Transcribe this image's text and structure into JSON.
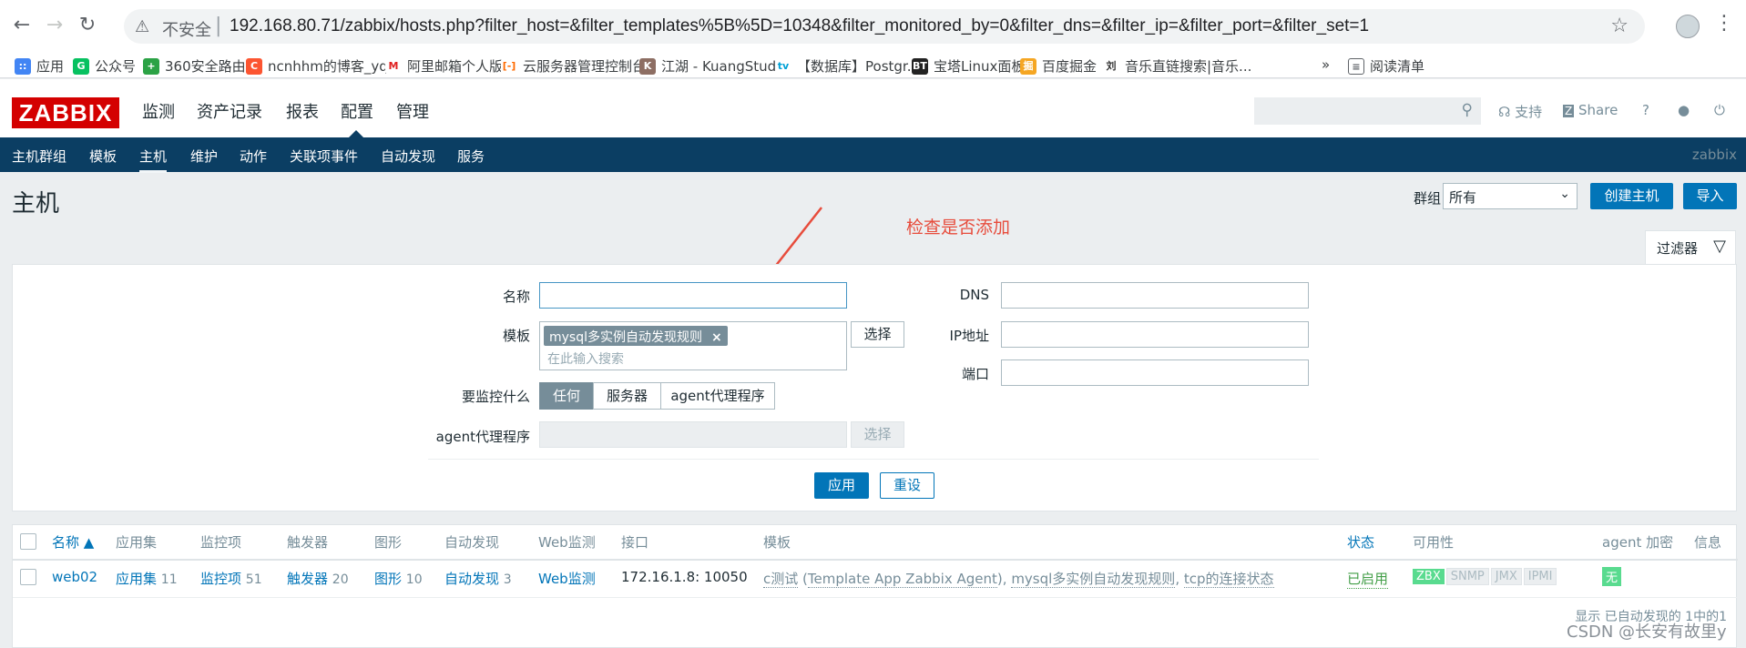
{
  "browser": {
    "insecure_label": "不安全",
    "url": "192.168.80.71/zabbix/hosts.php?filter_host=&filter_templates%5B%5D=10348&filter_monitored_by=0&filter_dns=&filter_ip=&filter_port=&filter_set=1",
    "bookmarks": [
      "应用",
      "公众号",
      "360安全路由",
      "ncnhhm的博客_yq...",
      "阿里邮箱个人版",
      "云服务器管理控制台",
      "江湖 - KuangStudy",
      "【数据库】Postgr...",
      "宝塔Linux面板",
      "百度掘金",
      "音乐直链搜索|音乐..."
    ],
    "more": "»",
    "reading_list": "阅读清单"
  },
  "header": {
    "logo": "ZABBIX",
    "menu": [
      "监测",
      "资产记录",
      "报表",
      "配置",
      "管理"
    ],
    "support": "支持",
    "share": "Share",
    "help": "?"
  },
  "subnav": {
    "items": [
      "主机群组",
      "模板",
      "主机",
      "维护",
      "动作",
      "关联项事件",
      "自动发现",
      "服务"
    ],
    "server_name": "zabbix"
  },
  "page": {
    "title": "主机",
    "group_label": "群组",
    "group_value": "所有",
    "create_button": "创建主机",
    "import_button": "导入"
  },
  "annotation": "检查是否添加",
  "filter": {
    "tab_label": "过滤器",
    "name_label": "名称",
    "templates_label": "模板",
    "template_tag": "mysql多实例自动发现规则",
    "search_placeholder": "在此输入搜索",
    "select_button": "选择",
    "monitored_label": "要监控什么",
    "monitored_options": [
      "任何",
      "服务器",
      "agent代理程序"
    ],
    "proxy_label": "agent代理程序",
    "dns_label": "DNS",
    "ip_label": "IP地址",
    "port_label": "端口",
    "apply_button": "应用",
    "reset_button": "重设"
  },
  "table": {
    "headers": [
      "名称 ▲",
      "应用集",
      "监控项",
      "触发器",
      "图形",
      "自动发现",
      "Web监测",
      "接口",
      "模板",
      "状态",
      "可用性",
      "agent 加密",
      "信息"
    ],
    "rows": [
      {
        "name": "web02",
        "applications": "应用集",
        "applications_count": "11",
        "items": "监控项",
        "items_count": "51",
        "triggers": "触发器",
        "triggers_count": "20",
        "graphs": "图形",
        "graphs_count": "10",
        "discovery": "自动发现",
        "discovery_count": "3",
        "web": "Web监测",
        "interface": "172.16.1.8: 10050",
        "template_1": "c测试",
        "template_1_paren": "Template App Zabbix Agent",
        "template_2": "mysql多实例自动发现规则",
        "template_3": "tcp的连接状态",
        "status": "已启用",
        "avail": [
          "ZBX",
          "SNMP",
          "JMX",
          "IPMI"
        ],
        "encryption": "无"
      }
    ],
    "footer": "显示 已自动发现的 1中的1"
  },
  "watermark": "CSDN @长安有故里y"
}
